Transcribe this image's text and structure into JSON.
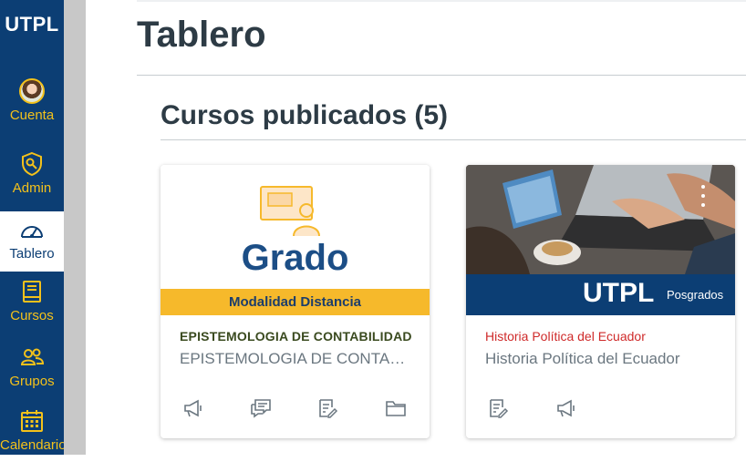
{
  "sidebar": {
    "logo": "UTPL",
    "items": [
      {
        "label": "Cuenta",
        "icon": "avatar"
      },
      {
        "label": "Admin",
        "icon": "shield-icon"
      },
      {
        "label": "Tablero",
        "icon": "dashboard-icon",
        "active": true
      },
      {
        "label": "Cursos",
        "icon": "book-icon"
      },
      {
        "label": "Grupos",
        "icon": "users-icon"
      },
      {
        "label": "Calendario",
        "icon": "calendar-icon"
      }
    ]
  },
  "main": {
    "title": "Tablero",
    "section": "Cursos publicados (5)"
  },
  "courses": [
    {
      "hero_text": "Grado",
      "hero_band": "Modalidad Distancia",
      "title": "EPISTEMOLOGIA DE CONTABILIDAD",
      "subtitle": "EPISTEMOLOGIA DE CONTABILIDAD",
      "actions": [
        "announcement-icon",
        "discussion-icon",
        "assignment-icon",
        "folder-icon"
      ]
    },
    {
      "hero_brand": "UTPL",
      "hero_brand_sub": "Posgrados",
      "title": "Historia Política del Ecuador",
      "subtitle": "Historia Política del Ecuador",
      "actions": [
        "assignment-icon",
        "announcement-icon"
      ]
    }
  ],
  "colors": {
    "sidebar_bg": "#0c3e74",
    "sidebar_accent": "#f3c11b",
    "band_yellow": "#f6b92b",
    "course_title_red": "#cf2a2a"
  }
}
